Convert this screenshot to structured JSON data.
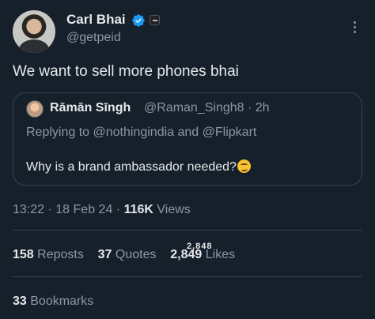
{
  "author": {
    "name": "Carl Bhai",
    "handle": "@getpeid"
  },
  "tweet": {
    "text": "We want to sell more phones bhai"
  },
  "quote": {
    "name": "Rāmān Sīngh",
    "handle": "@Raman_Singh8",
    "separator": "·",
    "time": "2h",
    "replying_prefix": "Replying to",
    "replying_to_1": "@nothingindia",
    "replying_and": "and",
    "replying_to_2": "@Flipkart",
    "text": "Why is a brand ambassador needed?"
  },
  "meta": {
    "time": "13:22",
    "dot1": "·",
    "date": "18 Feb 24",
    "dot2": "·",
    "views_count": "116K",
    "views_label": "Views"
  },
  "stats": {
    "reposts_count": "158",
    "reposts_label": "Reposts",
    "quotes_count": "37",
    "quotes_label": "Quotes",
    "likes_count": "2,849",
    "likes_ghost": "2,848",
    "likes_label": "Likes",
    "bookmarks_count": "33",
    "bookmarks_label": "Bookmarks"
  },
  "colors": {
    "background": "#15202b",
    "text": "#e7e9ea",
    "secondary": "#8b98a5",
    "verified": "#1d9bf0",
    "border": "#38444d"
  },
  "icons": {
    "verified": "verified-badge-icon",
    "affiliation": "affiliation-badge-icon",
    "more": "more-options-icon",
    "emoji": "smirking-face-emoji"
  }
}
